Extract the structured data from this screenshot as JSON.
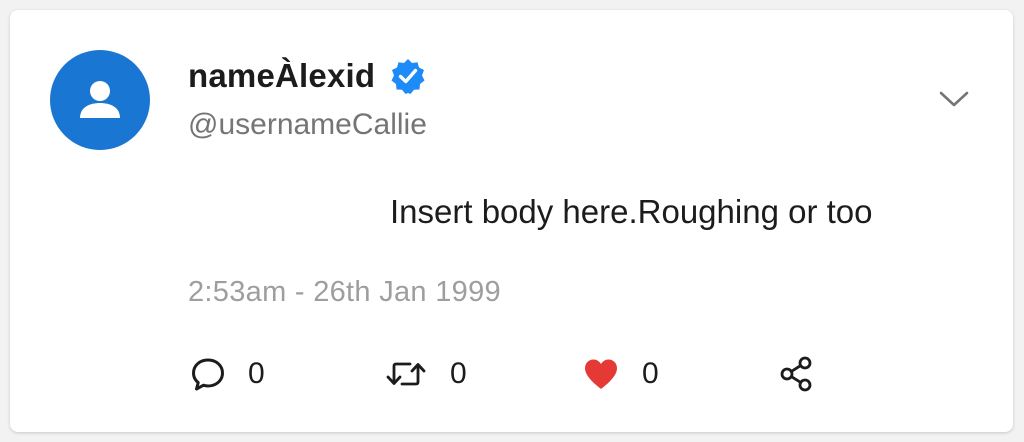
{
  "author": {
    "display_name": "nameÀlexid",
    "username": "@usernameCallie",
    "verified": true,
    "avatar_color": "#1976d2",
    "verified_color": "#1d8cf8"
  },
  "tweet": {
    "body": "Insert body here.Roughing or too",
    "timestamp": "2:53am - 26th Jan 1999"
  },
  "actions": {
    "reply_count": "0",
    "retweet_count": "0",
    "like_count": "0",
    "like_color": "#e53935"
  },
  "icons": {
    "avatar": "person-icon",
    "verified": "verified-badge-icon",
    "menu": "chevron-down-icon",
    "reply": "comment-bubble-icon",
    "retweet": "retweet-icon",
    "like": "heart-icon",
    "share": "share-icon"
  }
}
